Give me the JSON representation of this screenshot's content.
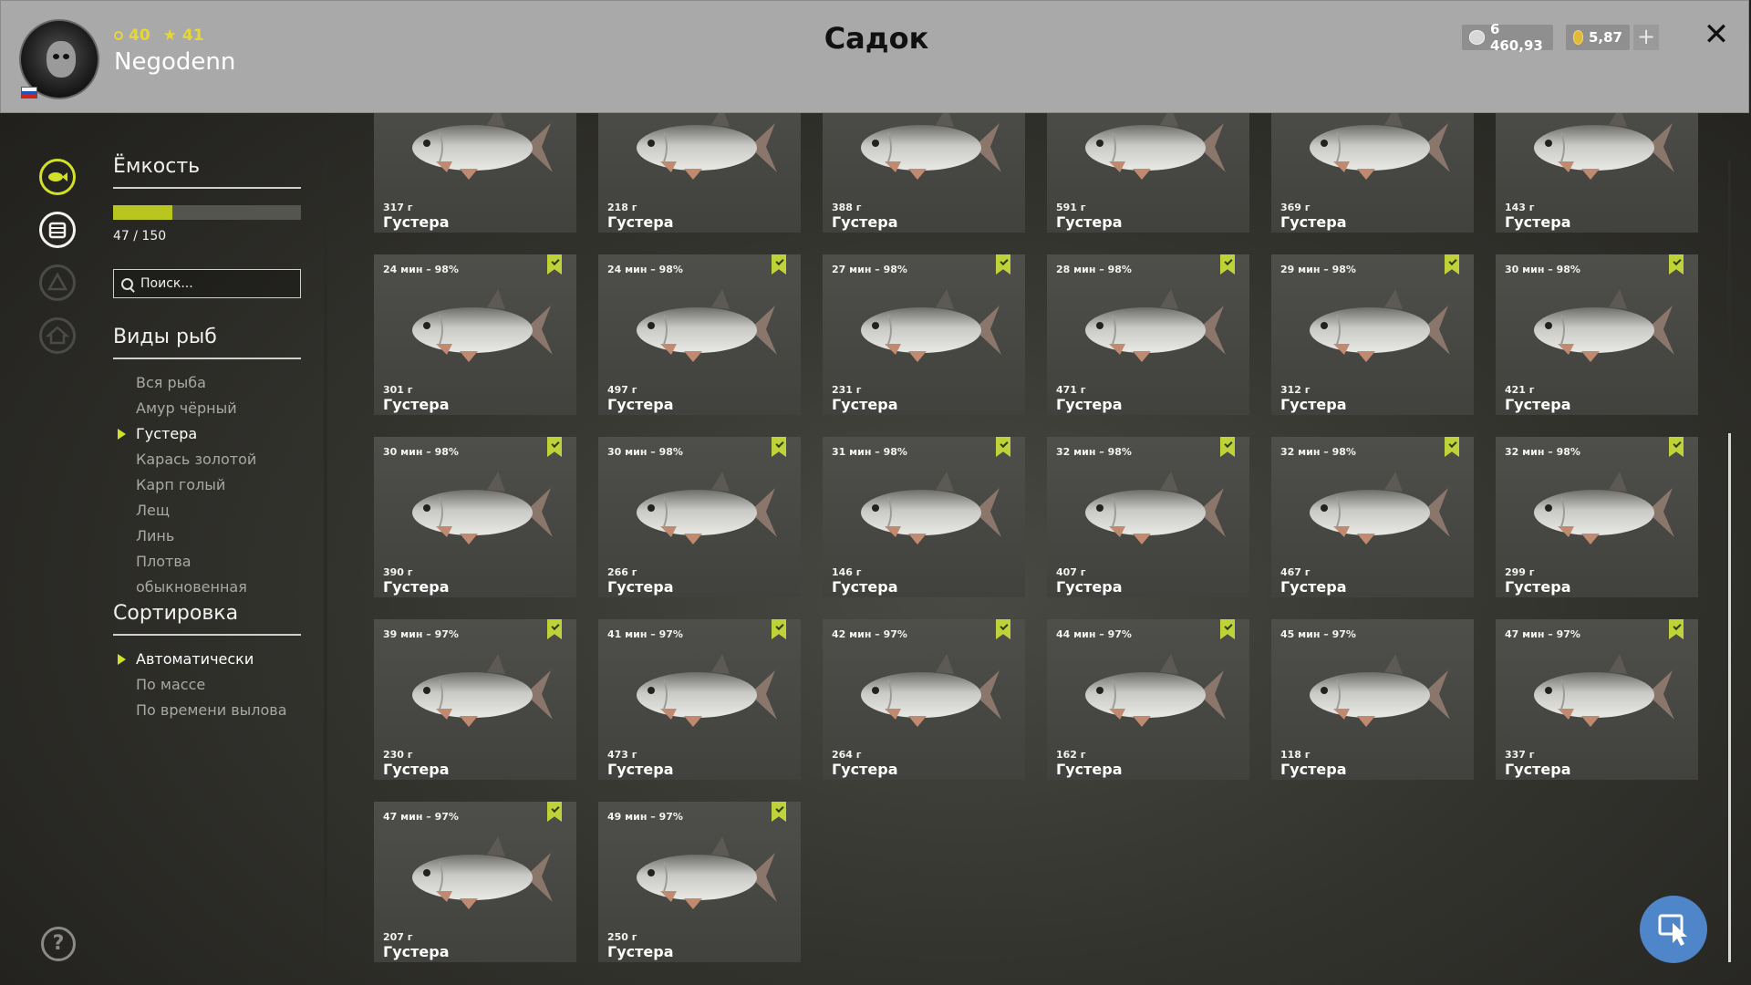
{
  "header": {
    "title": "Садок",
    "username": "Negodenn",
    "level": "40",
    "rank": "41",
    "silver": "6 460,93",
    "gold": "5,87",
    "plus_label": "+",
    "close_label": "✕",
    "colors": {
      "accent": "#d2e02a",
      "header_bg": "#a9a9a9"
    }
  },
  "capacity": {
    "title": "Ёмкость",
    "current": 47,
    "max": 150,
    "label": "47 / 150"
  },
  "search": {
    "placeholder": "Поиск..."
  },
  "species": {
    "title": "Виды рыб",
    "items": [
      {
        "label": "Вся рыба",
        "selected": false
      },
      {
        "label": "Амур чёрный",
        "selected": false
      },
      {
        "label": "Густера",
        "selected": true
      },
      {
        "label": "Карась золотой",
        "selected": false
      },
      {
        "label": "Карп голый",
        "selected": false
      },
      {
        "label": "Лещ",
        "selected": false
      },
      {
        "label": "Линь",
        "selected": false
      },
      {
        "label": "Плотва обыкновенная",
        "selected": false
      }
    ]
  },
  "sort": {
    "title": "Сортировка",
    "items": [
      {
        "label": "Автоматически",
        "selected": true
      },
      {
        "label": "По массе",
        "selected": false
      },
      {
        "label": "По времени вылова",
        "selected": false
      }
    ]
  },
  "help_label": "?",
  "fish": [
    {
      "time": "",
      "weight": "317 г",
      "name": "Густера",
      "bookmark": false
    },
    {
      "time": "",
      "weight": "218 г",
      "name": "Густера",
      "bookmark": false
    },
    {
      "time": "",
      "weight": "388 г",
      "name": "Густера",
      "bookmark": false
    },
    {
      "time": "",
      "weight": "591 г",
      "name": "Густера",
      "bookmark": false
    },
    {
      "time": "",
      "weight": "369 г",
      "name": "Густера",
      "bookmark": false
    },
    {
      "time": "",
      "weight": "143 г",
      "name": "Густера",
      "bookmark": false
    },
    {
      "time": "24 мин – 98%",
      "weight": "301 г",
      "name": "Густера",
      "bookmark": true
    },
    {
      "time": "24 мин – 98%",
      "weight": "497 г",
      "name": "Густера",
      "bookmark": true
    },
    {
      "time": "27 мин – 98%",
      "weight": "231 г",
      "name": "Густера",
      "bookmark": true
    },
    {
      "time": "28 мин – 98%",
      "weight": "471 г",
      "name": "Густера",
      "bookmark": true
    },
    {
      "time": "29 мин – 98%",
      "weight": "312 г",
      "name": "Густера",
      "bookmark": true
    },
    {
      "time": "30 мин – 98%",
      "weight": "421 г",
      "name": "Густера",
      "bookmark": true
    },
    {
      "time": "30 мин – 98%",
      "weight": "390 г",
      "name": "Густера",
      "bookmark": true
    },
    {
      "time": "30 мин – 98%",
      "weight": "266 г",
      "name": "Густера",
      "bookmark": true
    },
    {
      "time": "31 мин – 98%",
      "weight": "146 г",
      "name": "Густера",
      "bookmark": true
    },
    {
      "time": "32 мин – 98%",
      "weight": "407 г",
      "name": "Густера",
      "bookmark": true
    },
    {
      "time": "32 мин – 98%",
      "weight": "467 г",
      "name": "Густера",
      "bookmark": true
    },
    {
      "time": "32 мин – 98%",
      "weight": "299 г",
      "name": "Густера",
      "bookmark": true
    },
    {
      "time": "39 мин – 97%",
      "weight": "230 г",
      "name": "Густера",
      "bookmark": true
    },
    {
      "time": "41 мин – 97%",
      "weight": "473 г",
      "name": "Густера",
      "bookmark": true
    },
    {
      "time": "42 мин – 97%",
      "weight": "264 г",
      "name": "Густера",
      "bookmark": true
    },
    {
      "time": "44 мин – 97%",
      "weight": "162 г",
      "name": "Густера",
      "bookmark": true
    },
    {
      "time": "45 мин – 97%",
      "weight": "118 г",
      "name": "Густера",
      "bookmark": false
    },
    {
      "time": "47 мин – 97%",
      "weight": "337 г",
      "name": "Густера",
      "bookmark": true
    },
    {
      "time": "47 мин – 97%",
      "weight": "207 г",
      "name": "Густера",
      "bookmark": true
    },
    {
      "time": "49 мин – 97%",
      "weight": "250 г",
      "name": "Густера",
      "bookmark": true
    }
  ]
}
